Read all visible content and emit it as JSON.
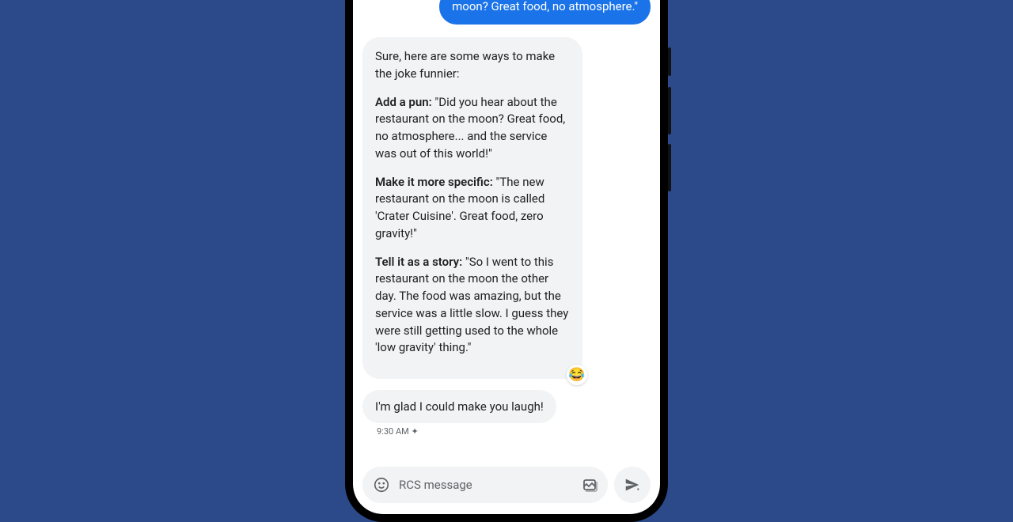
{
  "messages": {
    "outgoing": "moon? Great food, no atmosphere.\"",
    "response": {
      "intro": "Sure, here are some ways to make the joke funnier:",
      "items": [
        {
          "label": "Add a pun:",
          "text": " \"Did you hear about the restaurant on the moon? Great food, no atmosphere... and the service was out of this world!\""
        },
        {
          "label": "Make it more specific:",
          "text": " \"The new restaurant on the moon is called 'Crater Cuisine'. Great food, zero gravity!\""
        },
        {
          "label": "Tell it as a story:",
          "text": " \"So I went to this restaurant on the moon the other day. The food was amazing, but the service was a little slow. I guess they were still getting used to the whole 'low gravity' thing.\""
        }
      ],
      "reaction": "😂"
    },
    "followup": "I'm glad I could make you laugh!",
    "timestamp": "9:30 AM ✦"
  },
  "input": {
    "placeholder": "RCS message"
  }
}
